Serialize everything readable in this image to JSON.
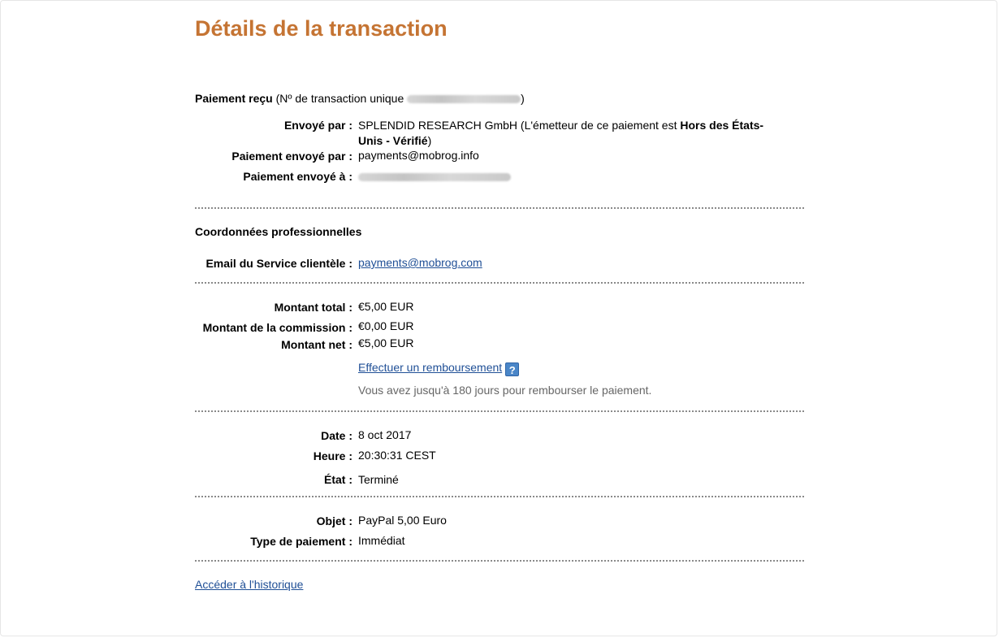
{
  "title": "Détails de la transaction",
  "payment": {
    "heading_bold": "Paiement reçu",
    "heading_open": " (Nº de transaction unique ",
    "heading_close": ")",
    "rows": {
      "sender_label": "Envoyé par :",
      "sender_value": "SPLENDID RESEARCH GmbH (L'émetteur de ce paiement est ",
      "sender_status_bold_1": "Hors des États-",
      "sender_status_bold_2": "Unis - Vérifié",
      "sender_close": ")",
      "sent_by_label": "Paiement envoyé par :",
      "sent_by_value": "payments@mobrog.info",
      "sent_to_label": "Paiement envoyé à :"
    }
  },
  "business": {
    "title": "Coordonnées professionnelles",
    "email_label": "Email du Service clientèle :",
    "email_value": "payments@mobrog.com"
  },
  "amounts": {
    "total_label": "Montant total :",
    "total_value": "€5,00 EUR",
    "fee_label": "Montant de la commission :",
    "fee_value": "€0,00 EUR",
    "net_label": "Montant net :",
    "net_value": "€5,00 EUR",
    "refund_link": "Effectuer un remboursement",
    "help_glyph": "?",
    "refund_note": "Vous avez jusqu'à 180 jours pour rembourser le paiement."
  },
  "details": {
    "date_label": "Date :",
    "date_value": "8 oct 2017",
    "time_label": "Heure :",
    "time_value": "20:30:31 CEST",
    "status_label": "État :",
    "status_value": "Terminé"
  },
  "item": {
    "object_label": "Objet :",
    "object_value": "PayPal 5,00 Euro",
    "type_label": "Type de paiement :",
    "type_value": "Immédiat"
  },
  "history_link": "Accéder à l'historique",
  "colors": {
    "title": "#c57433",
    "link": "#1f4f96",
    "note": "#666666",
    "help_icon": "#4a86c8"
  }
}
